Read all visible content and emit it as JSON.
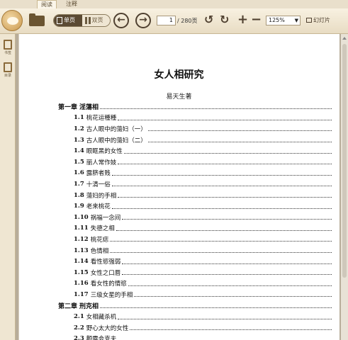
{
  "tabs": [
    {
      "label": "阅读",
      "active": true
    },
    {
      "label": "注释",
      "active": false
    }
  ],
  "toolbar": {
    "single_page_label": "单页",
    "double_page_label": "双页",
    "current_page": "1",
    "page_total": "/ 280页",
    "zoom_value": "125%",
    "slideshow_label": "幻灯片",
    "icons": [
      "logo-icon",
      "folder-icon",
      "prev-page-icon",
      "next-page-icon",
      "rotate-left-icon",
      "rotate-right-icon",
      "zoom-in-icon",
      "zoom-out-icon"
    ]
  },
  "sidebar": {
    "items": [
      {
        "label": "书签",
        "icon": "bookmark-icon"
      },
      {
        "label": "目录",
        "icon": "toc-icon"
      }
    ]
  },
  "document": {
    "title": "女人相研究",
    "author": "易天生著",
    "toc": [
      {
        "type": "chapter",
        "num": "第一章",
        "text": "淫蕩相"
      },
      {
        "type": "section",
        "num": "1.1",
        "text": "桃花运種種"
      },
      {
        "type": "section",
        "num": "1.2",
        "text": "古人眼中的蕩妇（一）"
      },
      {
        "type": "section",
        "num": "1.3",
        "text": "古人眼中的蕩妇（二）"
      },
      {
        "type": "section",
        "num": "1.4",
        "text": "眼眶黑的女性"
      },
      {
        "type": "section",
        "num": "1.5",
        "text": "丽人常作妓"
      },
      {
        "type": "section",
        "num": "1.6",
        "text": "露脐者贱"
      },
      {
        "type": "section",
        "num": "1.7",
        "text": "十清一俗"
      },
      {
        "type": "section",
        "num": "1.8",
        "text": "蕩妇的手相"
      },
      {
        "type": "section",
        "num": "1.9",
        "text": "老来桃花"
      },
      {
        "type": "section",
        "num": "1.10",
        "text": "祸福一念间"
      },
      {
        "type": "section",
        "num": "1.11",
        "text": "失德之相"
      },
      {
        "type": "section",
        "num": "1.12",
        "text": "桃花痣"
      },
      {
        "type": "section",
        "num": "1.13",
        "text": "色情相"
      },
      {
        "type": "section",
        "num": "1.14",
        "text": "看性慾强弱"
      },
      {
        "type": "section",
        "num": "1.15",
        "text": "女性之口唇"
      },
      {
        "type": "section",
        "num": "1.16",
        "text": "看女性的情慾"
      },
      {
        "type": "section",
        "num": "1.17",
        "text": "三级女星的手相"
      },
      {
        "type": "chapter",
        "num": "第二章",
        "text": "刑克相"
      },
      {
        "type": "section",
        "num": "2.1",
        "text": "女相藏杀机"
      },
      {
        "type": "section",
        "num": "2.2",
        "text": "野心太大的女性"
      },
      {
        "type": "section",
        "num": "2.3",
        "text": "颧露会克夫"
      }
    ]
  },
  "colors": {
    "toolbar_bg": "#f3ead6",
    "accent_dark": "#5b4a33",
    "workspace_bg": "#b8ad9a",
    "page_bg": "#ffffff"
  }
}
